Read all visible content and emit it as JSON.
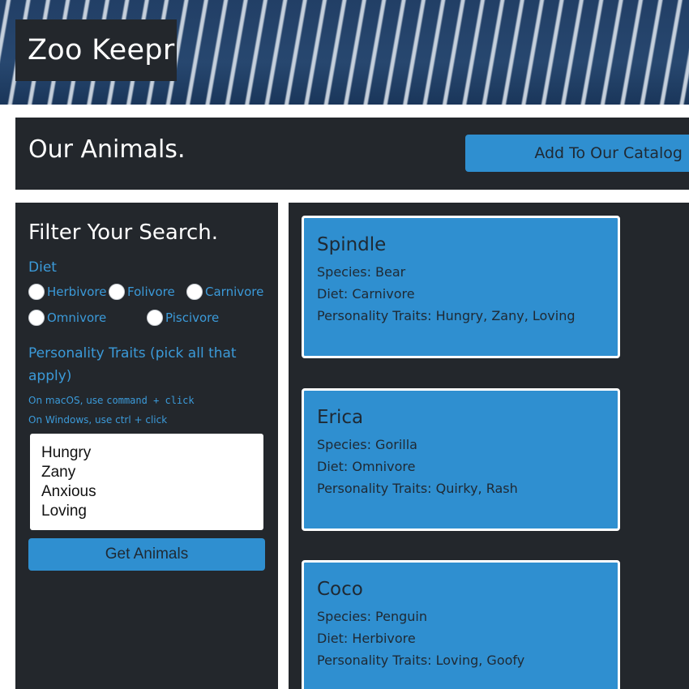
{
  "header": {
    "brand": "Zoo Keepr"
  },
  "band": {
    "title": "Our Animals.",
    "add_button": "Add To Our Catalog"
  },
  "filter": {
    "title": "Filter Your Search.",
    "diet_label": "Diet",
    "diets": [
      "Herbivore",
      "Folivore",
      "Carnivore",
      "Omnivore",
      "Piscivore"
    ],
    "traits_label": "Personality Traits (pick all that apply)",
    "hint_mac_prefix": "On macOS, use ",
    "hint_mac_code": "command + click",
    "hint_windows": "On Windows, use ctrl + click",
    "traits": [
      "Hungry",
      "Zany",
      "Anxious",
      "Loving"
    ],
    "get_button": "Get Animals"
  },
  "animals": [
    {
      "name": "Spindle",
      "species": "Species: Bear",
      "diet": "Diet: Carnivore",
      "traits": "Personality Traits: Hungry, Zany, Loving"
    },
    {
      "name": "Erica",
      "species": "Species: Gorilla",
      "diet": "Diet: Omnivore",
      "traits": "Personality Traits: Quirky, Rash"
    },
    {
      "name": "Coco",
      "species": "Species: Penguin",
      "diet": "Diet: Herbivore",
      "traits": "Personality Traits: Loving, Goofy"
    }
  ]
}
